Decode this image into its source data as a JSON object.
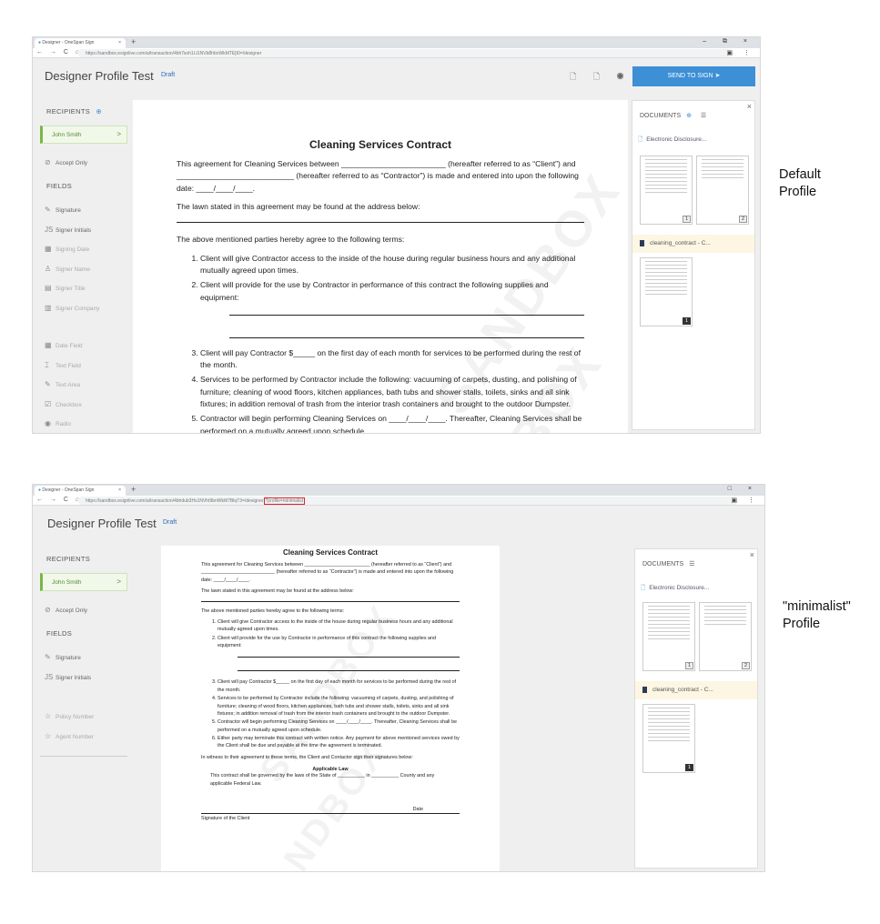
{
  "browser": {
    "tab_title": "Designer - OneSpan Sign",
    "tab_close": "×",
    "new_tab": "+",
    "nav": "← → C ⌂",
    "url_default": "https://sandbox.esignlive.com/a/transaction/4bhTsoh1Lt1NVb8hbnWkMTE[t0=/designer",
    "url_minimalist_base": "https://sandbox.esignlive.com/a/transaction/4bhdub3Hs1NVht9bnWkM7BlqT3=/designer",
    "url_minimalist_highlight": "?profile=minimalist",
    "window_controls_default": "– ⧉ ×",
    "window_controls_minimalist": "□ ×",
    "url_icons": "▣ ⋮"
  },
  "app": {
    "title": "Designer Profile Test",
    "status": "Draft",
    "send_button": "SEND TO SIGN ➤",
    "toolbar_icons": [
      "document-settings-icon",
      "document-copy-icon",
      "preview-eye-icon"
    ],
    "toolbar_glyphs": "🗋 🗋 ◉"
  },
  "sidebar_default": {
    "recipients_heading": "RECIPIENTS",
    "add_recipient_glyph": "⊕",
    "recipient": "John Smith",
    "chevron": ">",
    "accept_only": "Accept Only",
    "fields_heading": "FIELDS",
    "fields": [
      {
        "label": "Signature",
        "icon": "✎",
        "dim": false
      },
      {
        "label": "Signer Initials",
        "icon": "JS",
        "dim": false
      },
      {
        "label": "Signing Date",
        "icon": "▦",
        "dim": true
      },
      {
        "label": "Signer Name",
        "icon": "♙",
        "dim": true
      },
      {
        "label": "Signer Title",
        "icon": "▤",
        "dim": true
      },
      {
        "label": "Signer Company",
        "icon": "▥",
        "dim": true
      },
      {
        "label": "Date Field",
        "icon": "▦",
        "dim": true
      },
      {
        "label": "Text Field",
        "icon": "⌶",
        "dim": true
      },
      {
        "label": "Text Area",
        "icon": "✎",
        "dim": true
      },
      {
        "label": "Checkbox",
        "icon": "☑",
        "dim": true
      },
      {
        "label": "Radio",
        "icon": "◉",
        "dim": true
      }
    ]
  },
  "sidebar_minimalist": {
    "recipients_heading": "RECIPIENTS",
    "recipient": "John Smith",
    "chevron": ">",
    "accept_only": "Accept Only",
    "fields_heading": "FIELDS",
    "fields": [
      {
        "label": "Signature",
        "icon": "✎",
        "dim": false
      },
      {
        "label": "Signer Initials",
        "icon": "JS",
        "dim": false
      }
    ],
    "custom_fields": [
      {
        "label": "Policy Number",
        "icon": "☆"
      },
      {
        "label": "Agent Number",
        "icon": "☆"
      }
    ]
  },
  "document": {
    "title": "Cleaning Services Contract",
    "watermark": "SANDBOX",
    "p1": "This agreement for Cleaning Services between ________________________ (hereafter referred to as “Client”) and ___________________________ (hereafter referred to as “Contractor”) is made and entered into upon the following date: ____/____/____.",
    "p2": "The lawn stated in this agreement may be found at the address below:",
    "p3": "The above mentioned parties hereby agree to the following terms:",
    "li1": "Client will give Contractor access to the inside of the house during regular business hours and any additional mutually agreed upon times.",
    "li2": "Client will provide for the use by Contractor in performance of this contract the following supplies and equipment:",
    "li3": "Client will pay Contractor $_____ on the first day of each month for services to be performed during the rest of the month.",
    "li4": "Services to be performed by Contractor include the following: vacuuming of carpets, dusting, and polishing of furniture; cleaning of wood floors, kitchen appliances, bath tubs and shower stalls, toilets, sinks and all sink fixtures; in addition removal of trash from the interior trash containers and brought to the outdoor Dumpster.",
    "li5": "Contractor will begin performing Cleaning Services on ____/____/____. Thereafter, Cleaning Services shall be performed on a mutually agreed upon schedule.",
    "li6": "Either party may terminate this contract with written notice. Any payment for above mentioned services owed by the Client shall be due and payable at the time the agreement is terminated.",
    "witness": "In witness to their agreement to these terms, the Client and Contactor sign their signatures below:",
    "law_heading": "Applicable Law",
    "law_text": "This contract shall be governed by the laws of the State of __________ in __________ County and any applicable Federal Law.",
    "date_label": "Date",
    "sig_label": "Signature of the Client"
  },
  "documents_panel": {
    "heading": "DOCUMENTS",
    "add_glyph": "⊕",
    "list_glyph": "☰",
    "close_glyph": "×",
    "electronic_disclosure": "Electronic Disclosure...",
    "disclosure_icon_glyph": "🗋",
    "disclosure_pages": [
      "1",
      "2"
    ],
    "contract": "cleaning_contract - C...",
    "contract_pages": [
      "1"
    ]
  },
  "labels": {
    "default_1": "Default",
    "default_2": "Profile",
    "minimalist_1": "\"minimalist\"",
    "minimalist_2": "Profile"
  }
}
